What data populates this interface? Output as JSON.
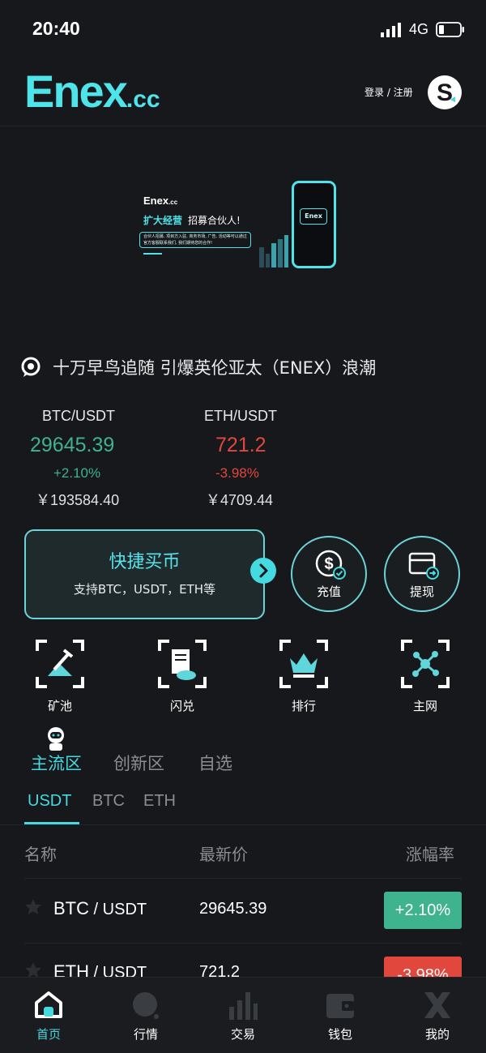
{
  "status_bar": {
    "time": "20:40",
    "network": "4G"
  },
  "header": {
    "logo_text": "Enex",
    "logo_suffix": ".cc",
    "login_label": "登录 / 注册",
    "avatar_letter": "S"
  },
  "banner": {
    "brand": "Enex",
    "brand_suffix": ".cc",
    "title_highlight": "扩大经营",
    "title_rest": "招募合伙人!",
    "note": "合伙人招募, 项目方入驻, 商务市场, 广告, 活动等可以通过官方客服联系我们, 我们期待您的合作!",
    "phone_label": "Enex"
  },
  "announcement": {
    "text": "十万早鸟追随 引爆英伦亚太（ENEX）浪潮"
  },
  "tickers": [
    {
      "pair": "BTC/USDT",
      "price": "29645.39",
      "change": "+2.10%",
      "cny": "￥193584.40",
      "direction": "up"
    },
    {
      "pair": "ETH/USDT",
      "price": "721.2",
      "change": "-3.98%",
      "cny": "￥4709.44",
      "direction": "down"
    }
  ],
  "quick_buy": {
    "title": "快捷买币",
    "subtitle": "支持BTC，USDT，ETH等"
  },
  "actions": {
    "deposit_label": "充值",
    "withdraw_label": "提现"
  },
  "features": [
    {
      "label": "矿池",
      "icon": "mining-pool-icon"
    },
    {
      "label": "闪兑",
      "icon": "flash-swap-icon"
    },
    {
      "label": "排行",
      "icon": "ranking-crown-icon"
    },
    {
      "label": "主网",
      "icon": "mainnet-node-icon"
    }
  ],
  "zone_tabs": [
    "主流区",
    "创新区",
    "自选"
  ],
  "currency_tabs": [
    "USDT",
    "BTC",
    "ETH"
  ],
  "table": {
    "headers": {
      "name": "名称",
      "price": "最新价",
      "change": "涨幅率"
    },
    "rows": [
      {
        "base": "BTC",
        "quote": " / USDT",
        "price": "29645.39",
        "change": "+2.10%",
        "direction": "up"
      },
      {
        "base": "ETH",
        "quote": " / USDT",
        "price": "721.2",
        "change": "-3.98%",
        "direction": "down"
      }
    ]
  },
  "bottom_nav": [
    {
      "label": "首页",
      "icon": "home-icon",
      "active": true
    },
    {
      "label": "行情",
      "icon": "market-search-icon",
      "active": false
    },
    {
      "label": "交易",
      "icon": "trade-bars-icon",
      "active": false
    },
    {
      "label": "钱包",
      "icon": "wallet-icon",
      "active": false
    },
    {
      "label": "我的",
      "icon": "profile-x-icon",
      "active": false
    }
  ],
  "colors": {
    "accent": "#45d9e0",
    "up": "#3fb28e",
    "down": "#e2473e",
    "background": "#17181b"
  }
}
